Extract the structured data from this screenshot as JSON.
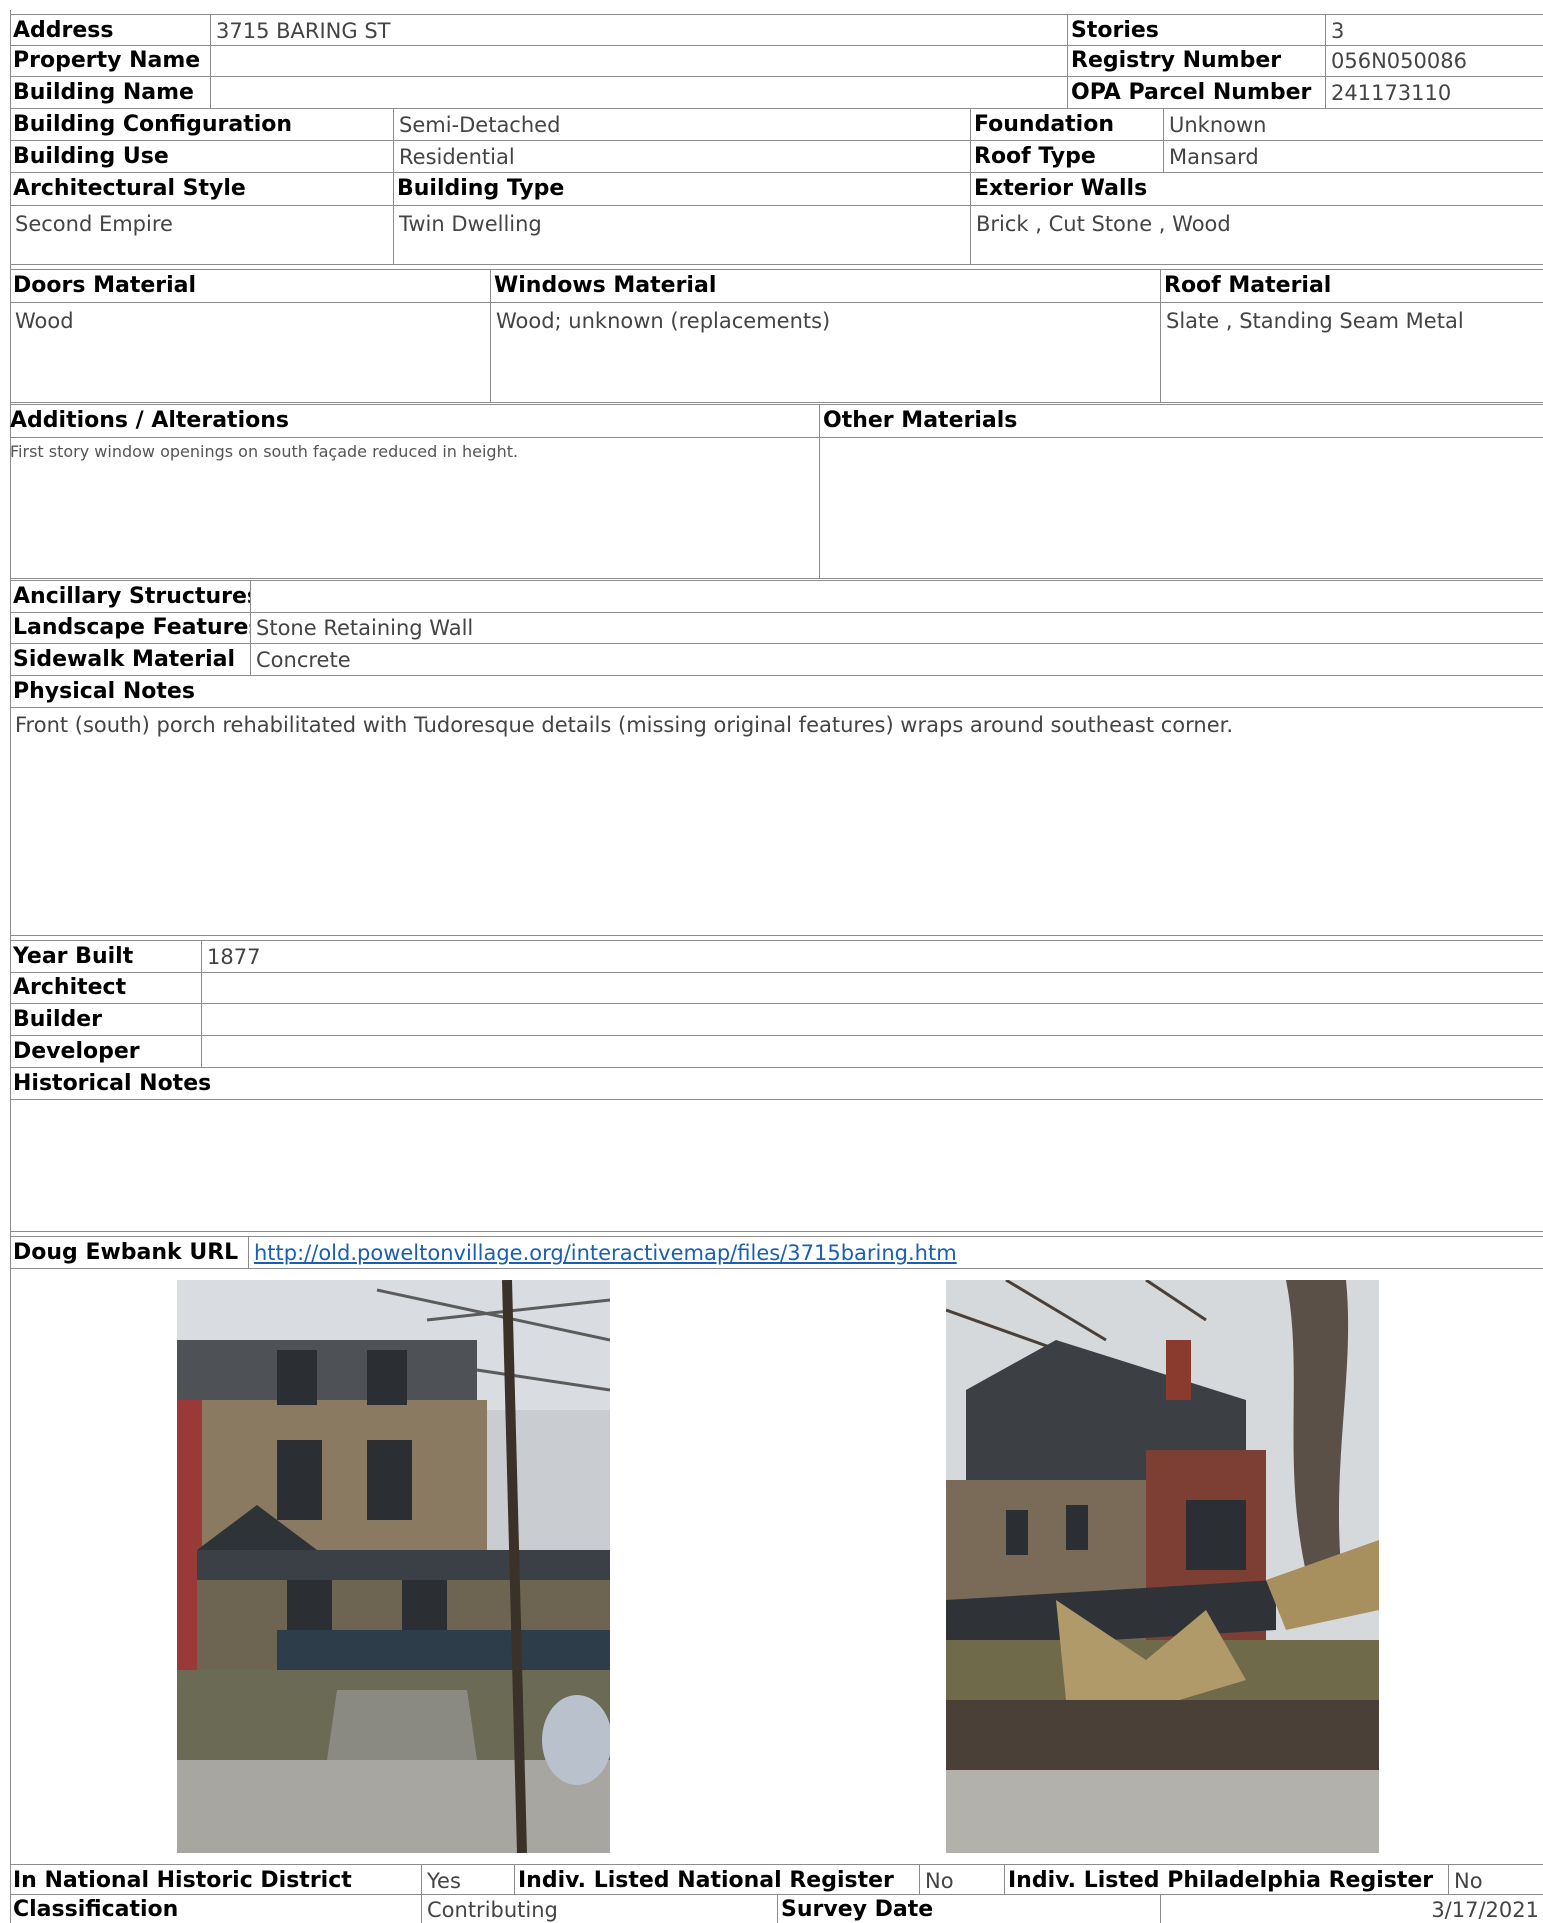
{
  "header": {
    "address_label": "Address",
    "address": "3715 BARING ST",
    "stories_label": "Stories",
    "stories": "3",
    "property_name_label": "Property Name",
    "property_name": "",
    "registry_label": "Registry Number",
    "registry": "056N050086",
    "building_name_label": "Building Name",
    "building_name": "",
    "opa_label": "OPA Parcel Number",
    "opa": "241173110"
  },
  "building": {
    "config_label": "Building Configuration",
    "config": "Semi-Detached",
    "foundation_label": "Foundation",
    "foundation": "Unknown",
    "use_label": "Building Use",
    "use": "Residential",
    "roof_type_label": "Roof Type",
    "roof_type": "Mansard",
    "style_label": "Architectural Style",
    "style": "Second Empire",
    "type_label": "Building Type",
    "type": "Twin Dwelling",
    "walls_label": "Exterior Walls",
    "walls": "Brick , Cut Stone , Wood"
  },
  "materials": {
    "doors_label": "Doors Material",
    "doors": "Wood",
    "windows_label": "Windows Material",
    "windows": "Wood; unknown (replacements)",
    "roof_label": "Roof Material",
    "roof": "Slate , Standing Seam Metal"
  },
  "alterations": {
    "label": "Additions / Alterations",
    "text": "First story window openings on south façade reduced in height.",
    "other_label": "Other Materials",
    "other": ""
  },
  "site": {
    "ancillary_label": "Ancillary Structures",
    "ancillary": "",
    "landscape_label": "Landscape Features",
    "landscape": "Stone Retaining Wall",
    "sidewalk_label": "Sidewalk Material",
    "sidewalk": "Concrete"
  },
  "physical_notes": {
    "label": "Physical Notes",
    "text": "Front (south) porch rehabilitated with Tudoresque details (missing original features) wraps around southeast corner."
  },
  "history": {
    "year_label": "Year Built",
    "year": "1877",
    "architect_label": "Architect",
    "architect": "",
    "builder_label": "Builder",
    "builder": "",
    "developer_label": "Developer",
    "developer": "",
    "notes_label": "Historical Notes",
    "notes": ""
  },
  "links": {
    "ewbank_label": "Doug Ewbank URL",
    "ewbank_url": "http://old.poweltonvillage.org/interactivemap/files/3715baring.htm"
  },
  "footer": {
    "district_label": "In National Historic District",
    "district": "Yes",
    "nat_reg_label": "Indiv. Listed National Register",
    "nat_reg": "No",
    "phila_reg_label": "Indiv. Listed Philadelphia Register",
    "phila_reg": "No",
    "class_label": "Classification",
    "class": "Contributing",
    "survey_label": "Survey Date",
    "survey": "3/17/2021"
  }
}
